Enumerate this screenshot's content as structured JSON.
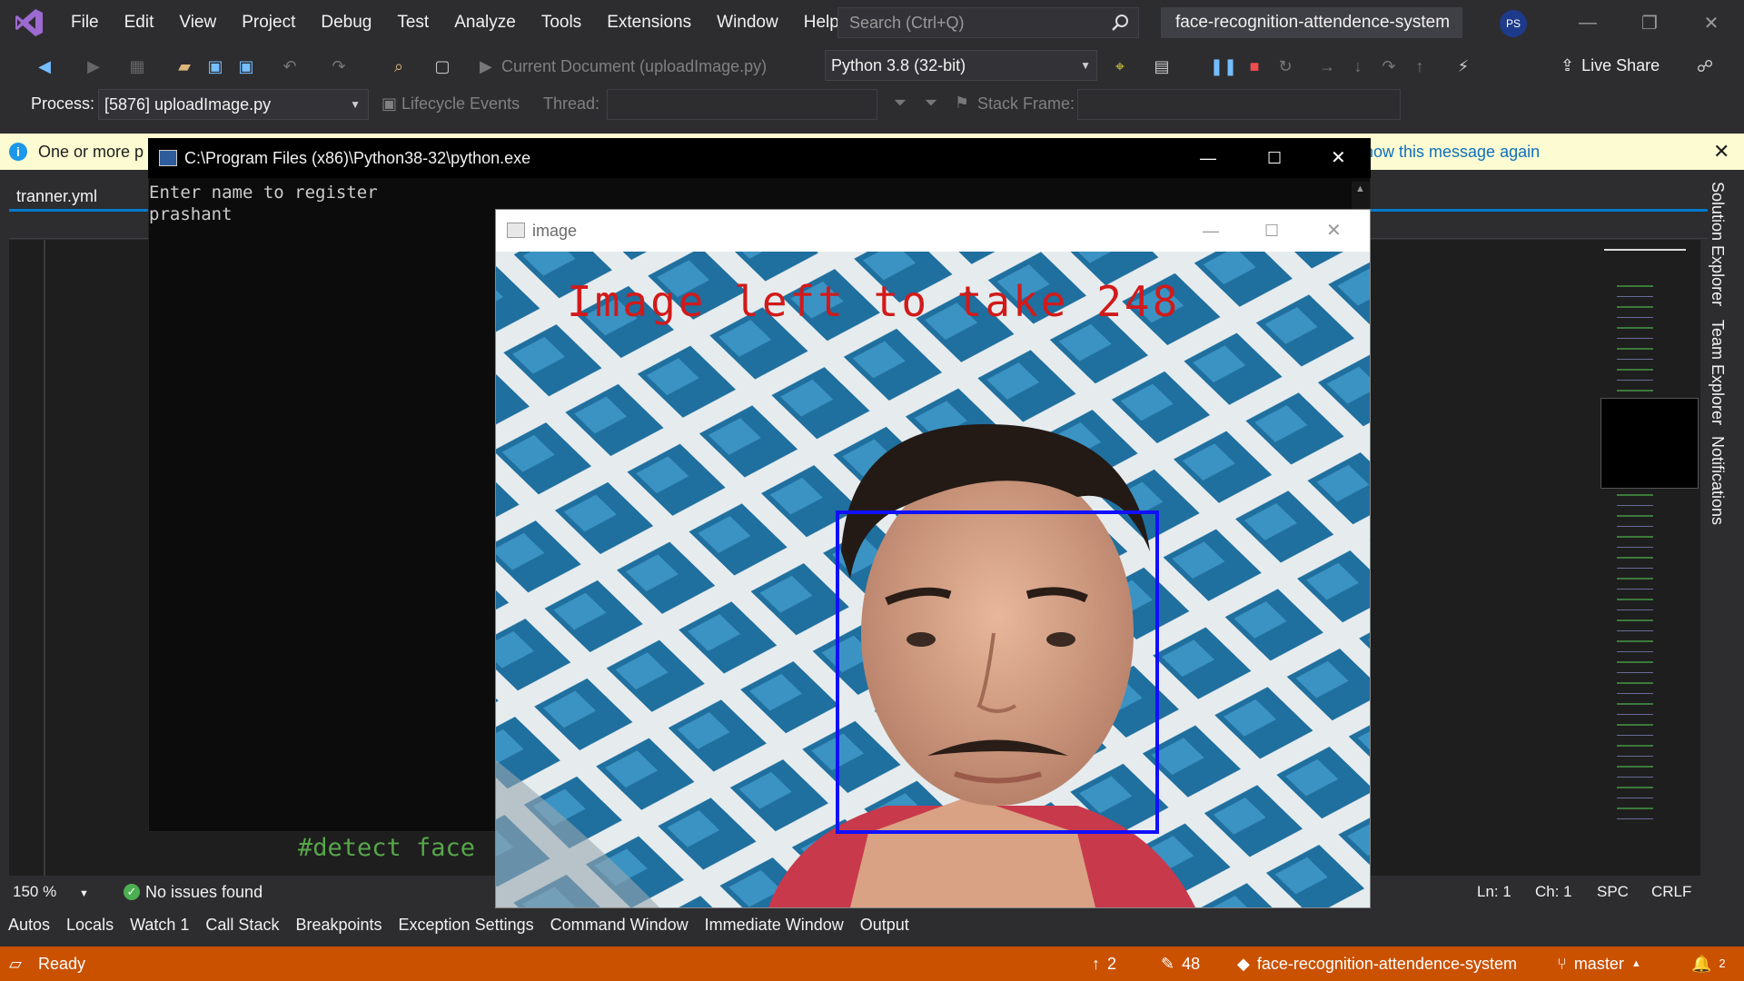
{
  "menubar": {
    "items": [
      "File",
      "Edit",
      "View",
      "Project",
      "Debug",
      "Test",
      "Analyze",
      "Tools",
      "Extensions",
      "Window",
      "Help"
    ],
    "search_placeholder": "Search (Ctrl+Q)",
    "solution_name": "face-recognition-attendence-system",
    "avatar_initials": "PS"
  },
  "toolbar": {
    "run_target": "Current Document (uploadImage.py)",
    "python_env": "Python 3.8 (32-bit)",
    "live_share": "Live Share"
  },
  "debug_toolbar": {
    "process_label": "Process:",
    "process_value": "[5876] uploadImage.py",
    "lifecycle_events": "Lifecycle Events",
    "thread_label": "Thread:",
    "stack_frame_label": "Stack Frame:"
  },
  "infobar": {
    "text": "One or more p",
    "link": "how this message again"
  },
  "editor": {
    "tab_title": "tranner.yml",
    "code_line": "#detect face",
    "zoom": "150 %",
    "issues": "No issues found",
    "ln": "Ln: 1",
    "ch": "Ch: 1",
    "spc": "SPC",
    "crlf": "CRLF"
  },
  "right_tabs": [
    "Solution Explorer",
    "Team Explorer",
    "Notifications"
  ],
  "tool_windows": [
    "Autos",
    "Locals",
    "Watch 1",
    "Call Stack",
    "Breakpoints",
    "Exception Settings",
    "Command Window",
    "Immediate Window",
    "Output"
  ],
  "statusbar": {
    "ready": "Ready",
    "up_count": "2",
    "pencil_count": "48",
    "repo": "face-recognition-attendence-system",
    "branch": "master",
    "notifications": "2"
  },
  "console": {
    "title": "C:\\Program Files (x86)\\Python38-32\\python.exe",
    "lines": [
      "Enter name to register",
      "prashant"
    ]
  },
  "image_window": {
    "title": "image",
    "overlay_text": "Image left to take 248"
  },
  "colors": {
    "accent": "#007acc",
    "statusbar": "#ca5100",
    "face_box": "#1010ff",
    "overlay_text": "#d11a1a"
  }
}
